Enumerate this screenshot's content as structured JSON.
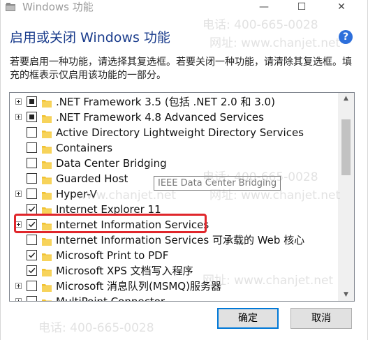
{
  "window": {
    "title": "Windows 功能",
    "minimize_glyph": "—",
    "maximize_glyph": "☐",
    "close_glyph": "✕"
  },
  "header": {
    "heading": "启用或关闭 Windows 功能",
    "help_glyph": "?",
    "description": "若要启用一种功能，请选择其复选框。若要关闭一种功能，请清除其复选框。填充的框表示仅启用该功能的一部分。"
  },
  "features": [
    {
      "label": ".NET Framework 3.5 (包括 .NET 2.0 和 3.0)",
      "state": "partial",
      "expandable": true
    },
    {
      "label": ".NET Framework 4.8 Advanced Services",
      "state": "partial",
      "expandable": true
    },
    {
      "label": "Active Directory Lightweight Directory Services",
      "state": "unchecked",
      "expandable": false
    },
    {
      "label": "Containers",
      "state": "unchecked",
      "expandable": false
    },
    {
      "label": "Data Center Bridging",
      "state": "unchecked",
      "expandable": false
    },
    {
      "label": "Guarded Host",
      "state": "unchecked",
      "expandable": false
    },
    {
      "label": "Hyper-V",
      "state": "unchecked",
      "expandable": true
    },
    {
      "label": "Internet Explorer 11",
      "state": "checked",
      "expandable": false
    },
    {
      "label": "Internet Information Services",
      "state": "checked",
      "expandable": true
    },
    {
      "label": "Internet Information Services 可承载的 Web 核心",
      "state": "unchecked",
      "expandable": false
    },
    {
      "label": "Microsoft Print to PDF",
      "state": "checked",
      "expandable": false
    },
    {
      "label": "Microsoft XPS 文档写入程序",
      "state": "checked",
      "expandable": false
    },
    {
      "label": "Microsoft 消息队列(MSMQ)服务器",
      "state": "unchecked",
      "expandable": true
    },
    {
      "label": "MultiPoint Connector",
      "state": "unchecked",
      "expandable": true
    }
  ],
  "tooltip": "IEEE Data Center Bridging",
  "buttons": {
    "ok": "确定",
    "cancel": "取消"
  },
  "watermark": {
    "phone": "电话: 400-665-0028",
    "site": "网址: www.chanjet.net",
    "site_short": "www.chanjet.net",
    "phone_short": "电话: 400-665-0028"
  },
  "colors": {
    "heading": "#1a3c8c",
    "accent": "#0078d7",
    "highlight": "#e0262b",
    "folder": "#f1c232"
  }
}
